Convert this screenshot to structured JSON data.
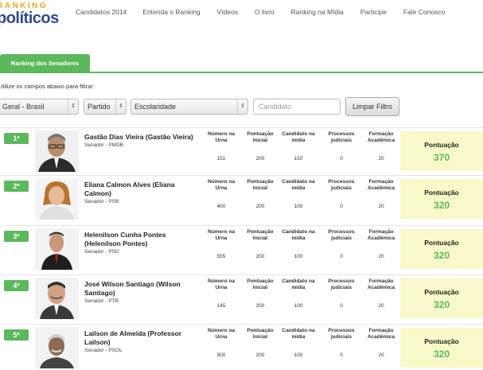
{
  "logo": {
    "top": "RANKING",
    "bottom_pre": "",
    "bottom": "políticos"
  },
  "nav": [
    "Candidatos 2014",
    "Entenda o Ranking",
    "Vídeos",
    "O livro",
    "Ranking na Mídia",
    "Participe",
    "Fale Conosco"
  ],
  "tabs": {
    "active": "Ranking dos Senadores"
  },
  "filter_hint": "Utilize os campos abaixo para filtrar:",
  "filters": {
    "region": "Geral - Brasil",
    "party": "Partido",
    "education": "Escolaridade",
    "candidate_placeholder": "Candidato",
    "clear_label": "Limpar Filtro",
    "arrow": "⇕"
  },
  "columns": [
    "Número na Urna",
    "Pontuação Inicial",
    "Candidato na mídia",
    "Processos judiciais",
    "Formação Acadêmica"
  ],
  "score_label": "Pontuação",
  "rows": [
    {
      "rank": "1º",
      "name": "Gastão Dias Vieira (Gastão Vieira)",
      "role": "Senador - PMDB",
      "values": [
        "151",
        "200",
        "150",
        "0",
        "20"
      ],
      "score": "370"
    },
    {
      "rank": "2º",
      "name": "Eliana Calmon Alves (Eliana Calmon)",
      "role": "Senador - PSB",
      "values": [
        "400",
        "200",
        "100",
        "0",
        "20"
      ],
      "score": "320"
    },
    {
      "rank": "3º",
      "name": "Helenilson Cunha Pontes (Helenilson Pontes)",
      "role": "Senador - PSD",
      "values": [
        "555",
        "200",
        "100",
        "0",
        "20"
      ],
      "score": "320"
    },
    {
      "rank": "4º",
      "name": "José Wilson Santiago (Wilson Santiago)",
      "role": "Senador - PTB",
      "values": [
        "145",
        "200",
        "100",
        "0",
        "20"
      ],
      "score": "320"
    },
    {
      "rank": "5º",
      "name": "Lailson de Almeida (Professor Lailson)",
      "role": "Senador - PSOL",
      "values": [
        "500",
        "200",
        "100",
        "0",
        "20"
      ],
      "score": "320"
    }
  ],
  "colors": {
    "accent": "#5cb85c",
    "score_bg": "#f8f8c8",
    "logo_blue": "#2d4a8a",
    "logo_orange": "#e8a52a"
  }
}
